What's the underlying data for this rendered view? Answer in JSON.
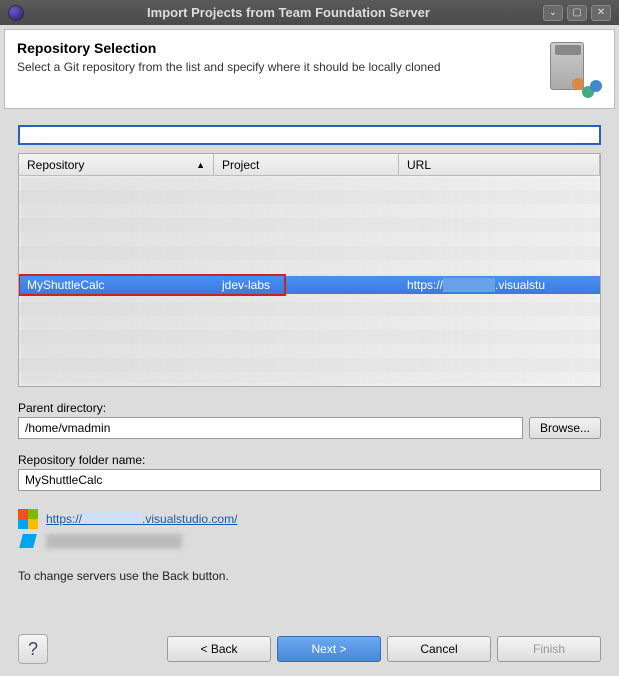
{
  "window": {
    "title": "Import Projects from Team Foundation Server"
  },
  "header": {
    "title": "Repository Selection",
    "subtitle": "Select a Git repository from the list and specify where it should be locally cloned"
  },
  "table": {
    "columns": {
      "repository": "Repository",
      "project": "Project",
      "url": "URL"
    },
    "selected": {
      "repository": "MyShuttleCalc",
      "project": "jdev-labs",
      "url_prefix": "https://",
      "url_suffix": ".visualstu"
    }
  },
  "fields": {
    "parentDir": {
      "label": "Parent directory:",
      "value": "/home/vmadmin",
      "browse": "Browse..."
    },
    "repoFolder": {
      "label": "Repository folder name:",
      "value": "MyShuttleCalc"
    }
  },
  "links": {
    "server_prefix": "https://",
    "server_suffix": ".visualstudio.com/"
  },
  "hint": "To change servers use the Back button.",
  "buttons": {
    "back": "< Back",
    "next": "Next >",
    "cancel": "Cancel",
    "finish": "Finish",
    "help": "?"
  }
}
